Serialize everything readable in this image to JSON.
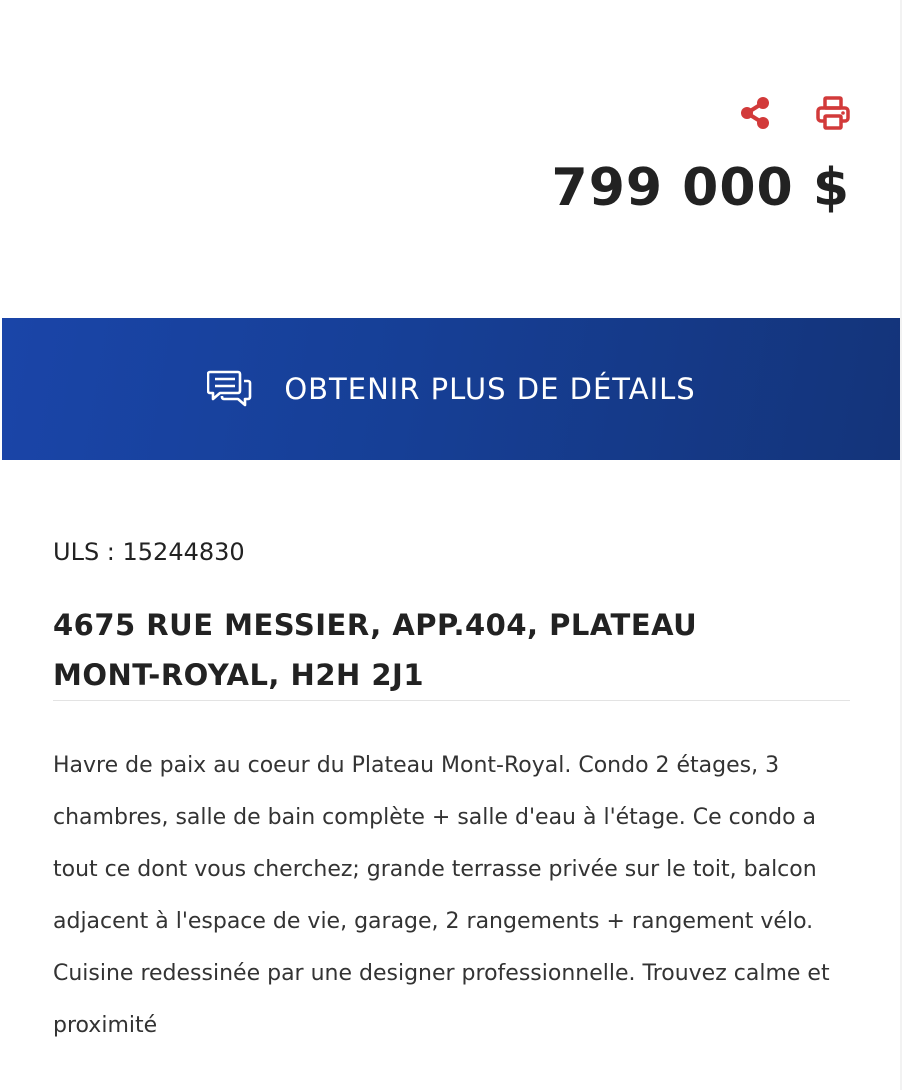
{
  "colors": {
    "accent_red": "#d23a3a",
    "banner_blue": "#173f98",
    "text": "#222222"
  },
  "actions": {
    "share_icon": "share-icon",
    "print_icon": "printer-icon"
  },
  "listing": {
    "price": "799 000 $",
    "cta_label": "OBTENIR PLUS DE DÉTAILS",
    "cta_icon": "chat-bubbles-icon",
    "uls": "ULS : 15244830",
    "address_line1": "4675 RUE MESSIER, APP.404, PLATEAU",
    "address_line2": "MONT-ROYAL, H2H 2J1",
    "description": "Havre de paix au coeur du Plateau Mont-Royal. Condo 2 étages, 3 chambres, salle de bain complète + salle d'eau à l'étage. Ce condo a tout ce dont vous cherchez; grande terrasse privée sur le toit, balcon adjacent à l'espace de vie, garage, 2 rangements + rangement vélo. Cuisine redessinée par une designer professionnelle. Trouvez calme et proximité"
  }
}
